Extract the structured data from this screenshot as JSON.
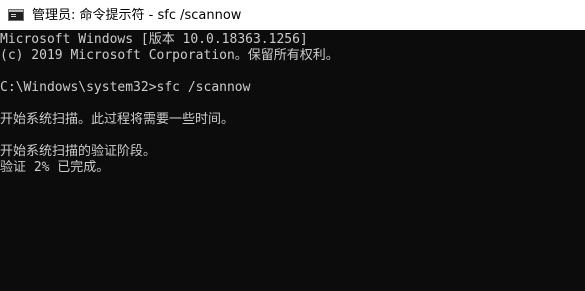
{
  "window": {
    "title": "管理员: 命令提示符 - sfc  /scannow",
    "icon": "cmd-icon"
  },
  "console": {
    "lines": [
      "Microsoft Windows [版本 10.0.18363.1256]",
      "(c) 2019 Microsoft Corporation。保留所有权利。",
      "",
      "C:\\Windows\\system32>sfc /scannow",
      "",
      "开始系统扫描。此过程将需要一些时间。",
      "",
      "开始系统扫描的验证阶段。",
      "验证 2% 已完成。"
    ]
  },
  "colors": {
    "console_background": "#0c0c0c",
    "console_text": "#cccccc",
    "titlebar_background": "#ffffff"
  }
}
